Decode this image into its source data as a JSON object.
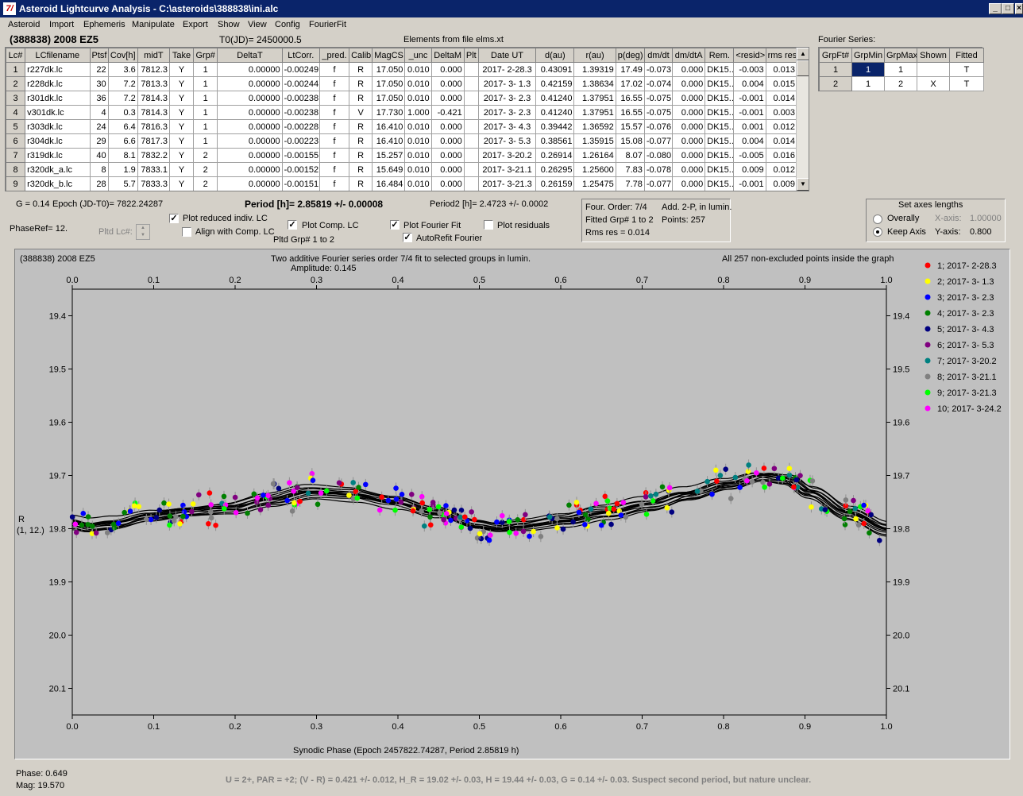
{
  "app": {
    "title": "Asteroid Lightcurve Analysis - C:\\asteroids\\388838\\ini.alc",
    "icon_glyph": "7/"
  },
  "menu": [
    "Asteroid",
    "Import",
    "Ephemeris",
    "Manipulate",
    "Export",
    "Show",
    "View",
    "Config",
    "FourierFit"
  ],
  "header": {
    "object": "(388838) 2008 EZ5",
    "t0": "T0(JD)= 2450000.5",
    "elements": "Elements from file elms.xt"
  },
  "lc_table": {
    "columns": [
      "Lc#",
      "LCfilename",
      "Ptsf",
      "Cov[h]",
      "midT",
      "Take",
      "Grp#",
      "DeltaT",
      "LtCorr.",
      "_pred.",
      "Calib.",
      "MagCS",
      "_unc",
      "DeltaM",
      "Plt",
      "Date UT",
      "d(au)",
      "r(au)",
      "p(deg)",
      "dm/dt",
      "dm/dtA",
      "Rem.",
      "<resid>",
      "rms res"
    ],
    "rows": [
      [
        "1",
        "r227dk.lc",
        "22",
        "3.6",
        "7812.3",
        "Y",
        "1",
        "0.00000",
        "-0.00249",
        "f",
        "R",
        "17.050",
        "0.010",
        "0.000",
        "",
        "2017- 2-28.3",
        "0.43091",
        "1.39319",
        "17.49",
        "-0.073",
        "0.000",
        "DK15...",
        "-0.003",
        "0.013"
      ],
      [
        "2",
        "r228dk.lc",
        "30",
        "7.2",
        "7813.3",
        "Y",
        "1",
        "0.00000",
        "-0.00244",
        "f",
        "R",
        "17.050",
        "0.010",
        "0.000",
        "",
        "2017- 3- 1.3",
        "0.42159",
        "1.38634",
        "17.02",
        "-0.074",
        "0.000",
        "DK15...",
        "0.004",
        "0.015"
      ],
      [
        "3",
        "r301dk.lc",
        "36",
        "7.2",
        "7814.3",
        "Y",
        "1",
        "0.00000",
        "-0.00238",
        "f",
        "R",
        "17.050",
        "0.010",
        "0.000",
        "",
        "2017- 3- 2.3",
        "0.41240",
        "1.37951",
        "16.55",
        "-0.075",
        "0.000",
        "DK15...",
        "-0.001",
        "0.014"
      ],
      [
        "4",
        "v301dk.lc",
        "4",
        "0.3",
        "7814.3",
        "Y",
        "1",
        "0.00000",
        "-0.00238",
        "f",
        "V",
        "17.730",
        "1.000",
        "-0.421",
        "",
        "2017- 3- 2.3",
        "0.41240",
        "1.37951",
        "16.55",
        "-0.075",
        "0.000",
        "DK15...",
        "-0.001",
        "0.003"
      ],
      [
        "5",
        "r303dk.lc",
        "24",
        "6.4",
        "7816.3",
        "Y",
        "1",
        "0.00000",
        "-0.00228",
        "f",
        "R",
        "16.410",
        "0.010",
        "0.000",
        "",
        "2017- 3- 4.3",
        "0.39442",
        "1.36592",
        "15.57",
        "-0.076",
        "0.000",
        "DK15...",
        "0.001",
        "0.012"
      ],
      [
        "6",
        "r304dk.lc",
        "29",
        "6.6",
        "7817.3",
        "Y",
        "1",
        "0.00000",
        "-0.00223",
        "f",
        "R",
        "16.410",
        "0.010",
        "0.000",
        "",
        "2017- 3- 5.3",
        "0.38561",
        "1.35915",
        "15.08",
        "-0.077",
        "0.000",
        "DK15...",
        "0.004",
        "0.014"
      ],
      [
        "7",
        "r319dk.lc",
        "40",
        "8.1",
        "7832.2",
        "Y",
        "2",
        "0.00000",
        "-0.00155",
        "f",
        "R",
        "15.257",
        "0.010",
        "0.000",
        "",
        "2017- 3-20.2",
        "0.26914",
        "1.26164",
        "8.07",
        "-0.080",
        "0.000",
        "DK15...",
        "-0.005",
        "0.016"
      ],
      [
        "8",
        "r320dk_a.lc",
        "8",
        "1.9",
        "7833.1",
        "Y",
        "2",
        "0.00000",
        "-0.00152",
        "f",
        "R",
        "15.649",
        "0.010",
        "0.000",
        "",
        "2017- 3-21.1",
        "0.26295",
        "1.25600",
        "7.83",
        "-0.078",
        "0.000",
        "DK15...",
        "0.009",
        "0.012"
      ],
      [
        "9",
        "r320dk_b.lc",
        "28",
        "5.7",
        "7833.3",
        "Y",
        "2",
        "0.00000",
        "-0.00151",
        "f",
        "R",
        "16.484",
        "0.010",
        "0.000",
        "",
        "2017- 3-21.3",
        "0.26159",
        "1.25475",
        "7.78",
        "-0.077",
        "0.000",
        "DK15...",
        "-0.001",
        "0.009"
      ]
    ]
  },
  "fourier_series": {
    "label": "Fourier Series:",
    "columns": [
      "GrpFt#",
      "GrpMin",
      "GrpMax",
      "Shown",
      "Fitted"
    ],
    "rows": [
      [
        "1",
        "1",
        "1",
        "",
        "T"
      ],
      [
        "2",
        "1",
        "2",
        "X",
        "T"
      ]
    ]
  },
  "info": {
    "g": "G = 0.14",
    "epoch": "Epoch (JD-T0)= 7822.24287",
    "period": "Period [h]= 2.85819 +/- 0.00008",
    "period2": "Period2 [h]= 2.4723 +/- 0.0002",
    "phaseref": "PhaseRef= 12.",
    "pltd_lc": "Pltd Lc#:",
    "pltd_grp": "Pltd Grp#  1   to   2",
    "cb_reduced": "Plot reduced indiv. LC",
    "cb_align": "Align with Comp. LC",
    "cb_comp": "Plot Comp. LC",
    "cb_fourier": "Plot Fourier Fit",
    "cb_autorefit": "AutoRefit Fourier",
    "cb_residuals": "Plot residuals",
    "four_order": "Four. Order:  7/4",
    "add": "Add. 2-P, in lumin.",
    "fitted_grp": "Fitted Grp# 1 to 2",
    "points": "Points: 257",
    "rms": "Rms res      = 0.014"
  },
  "axes_box": {
    "title": "Set axes lengths",
    "overally": "Overally",
    "keep": "Keep Axis",
    "xaxis_label": "X-axis:",
    "xaxis_val": "1.00000",
    "yaxis_label": "Y-axis:",
    "yaxis_val": "0.800"
  },
  "plot_text": {
    "object": "(388838) 2008 EZ5",
    "title": "Two additive Fourier series order 7/4 fit to selected groups in lumin.",
    "amplitude": "Amplitude: 0.145",
    "note": "All 257 non-excluded points inside the graph",
    "ylabel1": "R",
    "ylabel2": "(1, 12.)",
    "xlabel": "Synodic Phase (Epoch 2457822.74287, Period 2.85819 h)"
  },
  "status": {
    "phase": "Phase:  0.649",
    "mag": "Mag:    19.570",
    "summary": "U = 2+,  PAR = +2;  (V - R) = 0.421 +/- 0.012,  H_R = 19.02 +/- 0.03,  H = 19.44 +/- 0.03,  G = 0.14 +/- 0.03.   Suspect second period, but nature unclear."
  },
  "chart_data": {
    "type": "scatter",
    "x_range": [
      0.0,
      1.0
    ],
    "y_range": [
      19.35,
      20.15
    ],
    "y_inverted": true,
    "x_ticks": [
      "0.0",
      "0.1",
      "0.2",
      "0.3",
      "0.4",
      "0.5",
      "0.6",
      "0.7",
      "0.8",
      "0.9",
      "1.0"
    ],
    "y_ticks": [
      "19.4",
      "19.5",
      "19.6",
      "19.7",
      "19.8",
      "19.9",
      "20.0",
      "20.1"
    ],
    "series": [
      {
        "name": "1; 2017- 2-28.3",
        "color": "#ff0000"
      },
      {
        "name": "2; 2017- 3- 1.3",
        "color": "#ffff00"
      },
      {
        "name": "3; 2017- 3- 2.3",
        "color": "#0000ff"
      },
      {
        "name": "4; 2017- 3- 2.3",
        "color": "#008000"
      },
      {
        "name": "5; 2017- 3- 4.3",
        "color": "#000080"
      },
      {
        "name": "6; 2017- 3- 5.3",
        "color": "#800080"
      },
      {
        "name": "7; 2017- 3-20.2",
        "color": "#008080"
      },
      {
        "name": "8; 2017- 3-21.1",
        "color": "#808080"
      },
      {
        "name": "9; 2017- 3-21.3",
        "color": "#00ff00"
      },
      {
        "name": "10; 2017- 3-24.2",
        "color": "#ff00ff"
      }
    ],
    "fit_curve": {
      "phase": [
        0.0,
        0.02,
        0.05,
        0.1,
        0.15,
        0.2,
        0.25,
        0.3,
        0.35,
        0.4,
        0.45,
        0.5,
        0.52,
        0.55,
        0.6,
        0.65,
        0.7,
        0.75,
        0.8,
        0.84,
        0.87,
        0.9,
        0.95,
        1.0
      ],
      "mag": [
        19.79,
        19.795,
        19.79,
        19.775,
        19.765,
        19.76,
        19.745,
        19.73,
        19.735,
        19.75,
        19.77,
        19.795,
        19.8,
        19.795,
        19.785,
        19.77,
        19.755,
        19.735,
        19.715,
        19.7,
        19.705,
        19.73,
        19.77,
        19.8
      ]
    }
  }
}
